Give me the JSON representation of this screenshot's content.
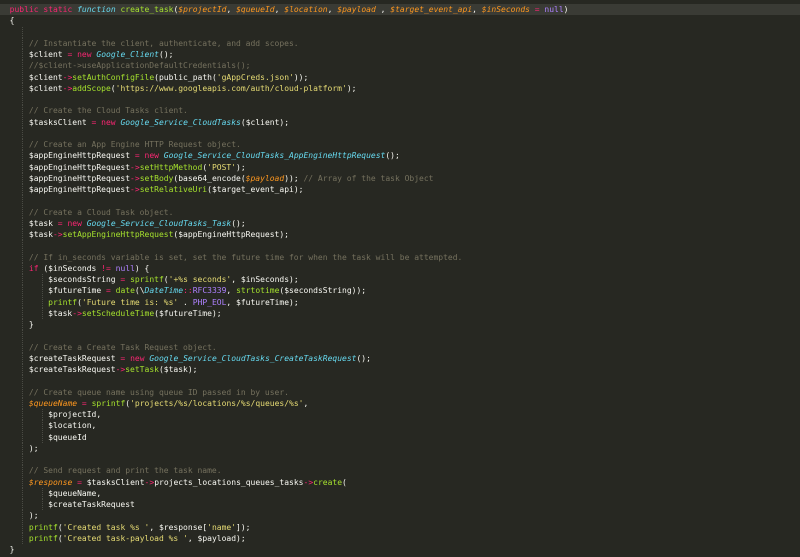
{
  "colors": {
    "background": "#272822",
    "text": "#F8F8F2",
    "keyword": "#F92672",
    "storage": "#66D9EF",
    "function_name": "#A6E22E",
    "variable": "#FD971F",
    "string": "#E6DB74",
    "comment": "#75715E",
    "constant": "#AE81FF"
  },
  "code": {
    "lines": [
      {
        "indent": 0,
        "tokens": [
          [
            "  ",
            "p"
          ],
          [
            "public",
            "k"
          ],
          [
            " ",
            "p"
          ],
          [
            "static",
            "k"
          ],
          [
            " ",
            "p"
          ],
          [
            "function",
            "s"
          ],
          [
            " ",
            "p"
          ],
          [
            "create_task",
            "f"
          ],
          [
            "(",
            "p"
          ],
          [
            "$projectId",
            "v"
          ],
          [
            ", ",
            "p"
          ],
          [
            "$queueId",
            "v"
          ],
          [
            ", ",
            "p"
          ],
          [
            "$location",
            "v"
          ],
          [
            ", ",
            "p"
          ],
          [
            "$payload",
            "v"
          ],
          [
            " , ",
            "p"
          ],
          [
            "$target_event_api",
            "v"
          ],
          [
            ", ",
            "p"
          ],
          [
            "$inSeconds",
            "v"
          ],
          [
            " = ",
            "k"
          ],
          [
            "null",
            "c"
          ],
          [
            ")",
            "p"
          ]
        ]
      },
      {
        "indent": 0,
        "tokens": [
          [
            "  {",
            "p"
          ]
        ]
      },
      {
        "indent": 1,
        "tokens": []
      },
      {
        "indent": 1,
        "tokens": [
          [
            "      // Instantiate the client, authenticate, and add scopes.",
            "m"
          ]
        ]
      },
      {
        "indent": 1,
        "tokens": [
          [
            "      $client ",
            "p"
          ],
          [
            "=",
            "k"
          ],
          [
            " ",
            "p"
          ],
          [
            "new",
            "k"
          ],
          [
            " ",
            "p"
          ],
          [
            "Google_Client",
            "s"
          ],
          [
            "();",
            "p"
          ]
        ]
      },
      {
        "indent": 1,
        "tokens": [
          [
            "      //$client->useApplicationDefaultCredentials();",
            "m"
          ]
        ]
      },
      {
        "indent": 1,
        "tokens": [
          [
            "      $client",
            "p"
          ],
          [
            "->",
            "k"
          ],
          [
            "setAuthConfigFile",
            "f"
          ],
          [
            "(public_path(",
            "p"
          ],
          [
            "'gAppCreds.json'",
            "g"
          ],
          [
            "));",
            "p"
          ]
        ]
      },
      {
        "indent": 1,
        "tokens": [
          [
            "      $client",
            "p"
          ],
          [
            "->",
            "k"
          ],
          [
            "addScope",
            "f"
          ],
          [
            "(",
            "p"
          ],
          [
            "'https://www.googleapis.com/auth/cloud-platform'",
            "g"
          ],
          [
            ");",
            "p"
          ]
        ]
      },
      {
        "indent": 1,
        "tokens": []
      },
      {
        "indent": 1,
        "tokens": [
          [
            "      // Create the Cloud Tasks client.",
            "m"
          ]
        ]
      },
      {
        "indent": 1,
        "tokens": [
          [
            "      $tasksClient ",
            "p"
          ],
          [
            "=",
            "k"
          ],
          [
            " ",
            "p"
          ],
          [
            "new",
            "k"
          ],
          [
            " ",
            "p"
          ],
          [
            "Google_Service_CloudTasks",
            "s"
          ],
          [
            "($client);",
            "p"
          ]
        ]
      },
      {
        "indent": 1,
        "tokens": []
      },
      {
        "indent": 1,
        "tokens": [
          [
            "      // Create an App Engine HTTP Request object.",
            "m"
          ]
        ]
      },
      {
        "indent": 1,
        "tokens": [
          [
            "      $appEngineHttpRequest ",
            "p"
          ],
          [
            "=",
            "k"
          ],
          [
            " ",
            "p"
          ],
          [
            "new",
            "k"
          ],
          [
            " ",
            "p"
          ],
          [
            "Google_Service_CloudTasks_AppEngineHttpRequest",
            "s"
          ],
          [
            "();",
            "p"
          ]
        ]
      },
      {
        "indent": 1,
        "tokens": [
          [
            "      $appEngineHttpRequest",
            "p"
          ],
          [
            "->",
            "k"
          ],
          [
            "setHttpMethod",
            "f"
          ],
          [
            "(",
            "p"
          ],
          [
            "'POST'",
            "g"
          ],
          [
            ");",
            "p"
          ]
        ]
      },
      {
        "indent": 1,
        "tokens": [
          [
            "      $appEngineHttpRequest",
            "p"
          ],
          [
            "->",
            "k"
          ],
          [
            "setBody",
            "f"
          ],
          [
            "(base64_encode(",
            "p"
          ],
          [
            "$payload",
            "v"
          ],
          [
            ")); ",
            "p"
          ],
          [
            "// Array of the task Object",
            "m"
          ]
        ]
      },
      {
        "indent": 1,
        "tokens": [
          [
            "      $appEngineHttpRequest",
            "p"
          ],
          [
            "->",
            "k"
          ],
          [
            "setRelativeUri",
            "f"
          ],
          [
            "($target_event_api);",
            "p"
          ]
        ]
      },
      {
        "indent": 1,
        "tokens": []
      },
      {
        "indent": 1,
        "tokens": [
          [
            "      // Create a Cloud Task object.",
            "m"
          ]
        ]
      },
      {
        "indent": 1,
        "tokens": [
          [
            "      $task ",
            "p"
          ],
          [
            "=",
            "k"
          ],
          [
            " ",
            "p"
          ],
          [
            "new",
            "k"
          ],
          [
            " ",
            "p"
          ],
          [
            "Google_Service_CloudTasks_Task",
            "s"
          ],
          [
            "();",
            "p"
          ]
        ]
      },
      {
        "indent": 1,
        "tokens": [
          [
            "      $task",
            "p"
          ],
          [
            "->",
            "k"
          ],
          [
            "setAppEngineHttpRequest",
            "f"
          ],
          [
            "($appEngineHttpRequest);",
            "p"
          ]
        ]
      },
      {
        "indent": 1,
        "tokens": []
      },
      {
        "indent": 1,
        "tokens": [
          [
            "      // If in_seconds variable is set, set the future time for when the task will be attempted.",
            "m"
          ]
        ]
      },
      {
        "indent": 1,
        "tokens": [
          [
            "      ",
            "p"
          ],
          [
            "if",
            "k"
          ],
          [
            " ($inSeconds ",
            "p"
          ],
          [
            "!=",
            "k"
          ],
          [
            " ",
            "p"
          ],
          [
            "null",
            "c"
          ],
          [
            ") {",
            "p"
          ]
        ]
      },
      {
        "indent": 2,
        "tokens": [
          [
            "          $secondsString ",
            "p"
          ],
          [
            "=",
            "k"
          ],
          [
            " ",
            "p"
          ],
          [
            "sprintf",
            "f"
          ],
          [
            "(",
            "p"
          ],
          [
            "'+%s seconds'",
            "g"
          ],
          [
            ", $inSeconds);",
            "p"
          ]
        ]
      },
      {
        "indent": 2,
        "tokens": [
          [
            "          $futureTime ",
            "p"
          ],
          [
            "=",
            "k"
          ],
          [
            " ",
            "p"
          ],
          [
            "date",
            "f"
          ],
          [
            "(\\",
            "p"
          ],
          [
            "DateTime",
            "s"
          ],
          [
            "::",
            "k"
          ],
          [
            "RFC3339",
            "c"
          ],
          [
            ", ",
            "p"
          ],
          [
            "strtotime",
            "f"
          ],
          [
            "($secondsString));",
            "p"
          ]
        ]
      },
      {
        "indent": 2,
        "tokens": [
          [
            "          ",
            "p"
          ],
          [
            "printf",
            "f"
          ],
          [
            "(",
            "p"
          ],
          [
            "'Future time is: %s'",
            "g"
          ],
          [
            " . ",
            "p"
          ],
          [
            "PHP_EOL",
            "c"
          ],
          [
            ", $futureTime);",
            "p"
          ]
        ]
      },
      {
        "indent": 2,
        "tokens": [
          [
            "          $task",
            "p"
          ],
          [
            "->",
            "k"
          ],
          [
            "setScheduleTime",
            "f"
          ],
          [
            "($futureTime);",
            "p"
          ]
        ]
      },
      {
        "indent": 1,
        "tokens": [
          [
            "      }",
            "p"
          ]
        ]
      },
      {
        "indent": 1,
        "tokens": []
      },
      {
        "indent": 1,
        "tokens": [
          [
            "      // Create a Create Task Request object.",
            "m"
          ]
        ]
      },
      {
        "indent": 1,
        "tokens": [
          [
            "      $createTaskRequest ",
            "p"
          ],
          [
            "=",
            "k"
          ],
          [
            " ",
            "p"
          ],
          [
            "new",
            "k"
          ],
          [
            " ",
            "p"
          ],
          [
            "Google_Service_CloudTasks_CreateTaskRequest",
            "s"
          ],
          [
            "();",
            "p"
          ]
        ]
      },
      {
        "indent": 1,
        "tokens": [
          [
            "      $createTaskRequest",
            "p"
          ],
          [
            "->",
            "k"
          ],
          [
            "setTask",
            "f"
          ],
          [
            "($task);",
            "p"
          ]
        ]
      },
      {
        "indent": 1,
        "tokens": []
      },
      {
        "indent": 1,
        "tokens": [
          [
            "      // Create queue name using queue ID passed in by user.",
            "m"
          ]
        ]
      },
      {
        "indent": 1,
        "tokens": [
          [
            "      ",
            "p"
          ],
          [
            "$queueName",
            "v"
          ],
          [
            " ",
            "p"
          ],
          [
            "=",
            "k"
          ],
          [
            " ",
            "p"
          ],
          [
            "sprintf",
            "f"
          ],
          [
            "(",
            "p"
          ],
          [
            "'projects/%s/locations/%s/queues/%s'",
            "g"
          ],
          [
            ",",
            "p"
          ]
        ]
      },
      {
        "indent": 2,
        "tokens": [
          [
            "          $projectId,",
            "p"
          ]
        ]
      },
      {
        "indent": 2,
        "tokens": [
          [
            "          $location,",
            "p"
          ]
        ]
      },
      {
        "indent": 2,
        "tokens": [
          [
            "          $queueId",
            "p"
          ]
        ]
      },
      {
        "indent": 1,
        "tokens": [
          [
            "      );",
            "p"
          ]
        ]
      },
      {
        "indent": 1,
        "tokens": []
      },
      {
        "indent": 1,
        "tokens": [
          [
            "      // Send request and print the task name.",
            "m"
          ]
        ]
      },
      {
        "indent": 1,
        "tokens": [
          [
            "      ",
            "p"
          ],
          [
            "$response",
            "v"
          ],
          [
            " ",
            "p"
          ],
          [
            "=",
            "k"
          ],
          [
            " $tasksClient",
            "p"
          ],
          [
            "->",
            "k"
          ],
          [
            "projects_locations_queues_tasks",
            "p"
          ],
          [
            "->",
            "k"
          ],
          [
            "create",
            "f"
          ],
          [
            "(",
            "p"
          ]
        ]
      },
      {
        "indent": 2,
        "tokens": [
          [
            "          $queueName,",
            "p"
          ]
        ]
      },
      {
        "indent": 2,
        "tokens": [
          [
            "          $createTaskRequest",
            "p"
          ]
        ]
      },
      {
        "indent": 1,
        "tokens": [
          [
            "      );",
            "p"
          ]
        ]
      },
      {
        "indent": 1,
        "tokens": [
          [
            "      ",
            "p"
          ],
          [
            "printf",
            "f"
          ],
          [
            "(",
            "p"
          ],
          [
            "'Created task %s '",
            "g"
          ],
          [
            ", $response[",
            "p"
          ],
          [
            "'name'",
            "g"
          ],
          [
            "]);",
            "p"
          ]
        ]
      },
      {
        "indent": 1,
        "tokens": [
          [
            "      ",
            "p"
          ],
          [
            "printf",
            "f"
          ],
          [
            "(",
            "p"
          ],
          [
            "'Created task-payload %s '",
            "g"
          ],
          [
            ", $payload);",
            "p"
          ]
        ]
      },
      {
        "indent": 0,
        "tokens": [
          [
            "  }",
            "p"
          ]
        ]
      }
    ]
  }
}
